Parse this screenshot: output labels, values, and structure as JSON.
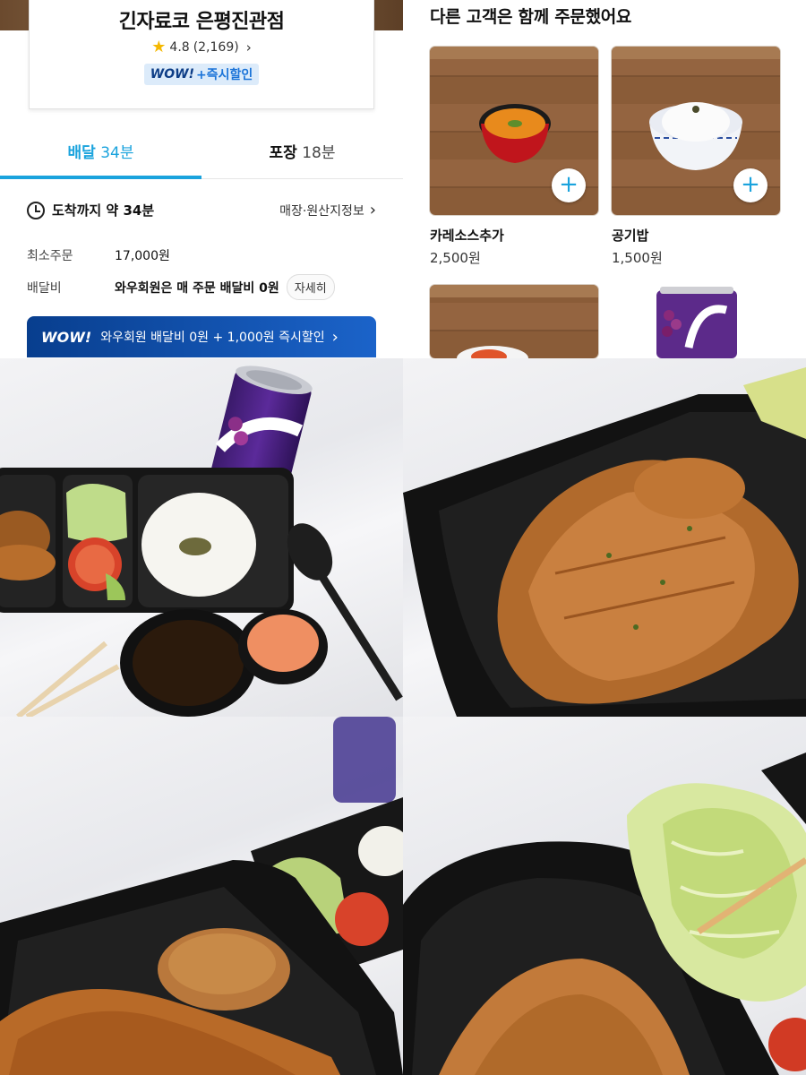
{
  "store": {
    "name": "긴자료코 은평진관점",
    "rating": "4.8",
    "review_count": "(2,169)",
    "wow_label": "WOW!",
    "discount_label": "+즉시할인"
  },
  "tabs": [
    {
      "label": "배달",
      "time": "34분"
    },
    {
      "label": "포장",
      "time": "18분"
    }
  ],
  "delivery": {
    "eta_label": "도착까지 약 34분",
    "store_info_link": "매장·원산지정보",
    "min_order_label": "최소주문",
    "min_order_value": "17,000원",
    "fee_label": "배달비",
    "fee_value": "와우회원은 매 주문 배달비 0원",
    "detail_button": "자세히"
  },
  "wow_banner": {
    "logo": "WOW!",
    "text": "와우회원 배달비 0원 + 1,000원 즉시할인"
  },
  "recommendations": {
    "title": "다른 고객은 함께 주문했어요",
    "items": [
      {
        "name": "카레소스추가",
        "price": "2,500원"
      },
      {
        "name": "공기밥",
        "price": "1,500원"
      }
    ]
  },
  "colors": {
    "accent": "#1aa3dd",
    "wow_blue": "#0d3d86",
    "star": "#f5b800"
  }
}
